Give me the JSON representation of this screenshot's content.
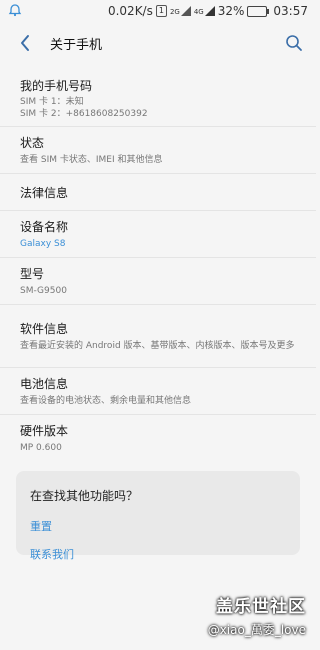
{
  "status_bar": {
    "speed": "0.02K/s",
    "sim_badge": "1",
    "network_4g": "4G",
    "network_2g": "2G",
    "battery_percent": "32%",
    "battery_level": 0.32,
    "time": "03:57"
  },
  "appbar": {
    "title": "关于手机"
  },
  "items": [
    {
      "title": "我的手机号码",
      "subtitle": "SIM 卡 1：未知",
      "subtitle2": "SIM 卡 2：+8618608250392"
    },
    {
      "title": "状态",
      "subtitle": "查看 SIM 卡状态、IMEI 和其他信息"
    },
    {
      "title": "法律信息"
    },
    {
      "title": "设备名称",
      "subtitle": "Galaxy S8"
    },
    {
      "title": "型号",
      "subtitle": "SM-G9500"
    },
    {
      "title": "软件信息",
      "subtitle": "查看最近安装的 Android 版本、基带版本、内核版本、版本号及更多"
    },
    {
      "title": "电池信息",
      "subtitle": "查看设备的电池状态、剩余电量和其他信息"
    },
    {
      "title": "硬件版本",
      "subtitle": "MP 0.600"
    }
  ],
  "card": {
    "question": "在查找其他功能吗？",
    "link1": "重置",
    "link2": "联系我们"
  },
  "watermark": {
    "line1": "盖乐世社区",
    "line2": "@xiao_萬委_love"
  },
  "colors": {
    "accent": "#3b8fd6",
    "background": "#f5f5f5"
  }
}
